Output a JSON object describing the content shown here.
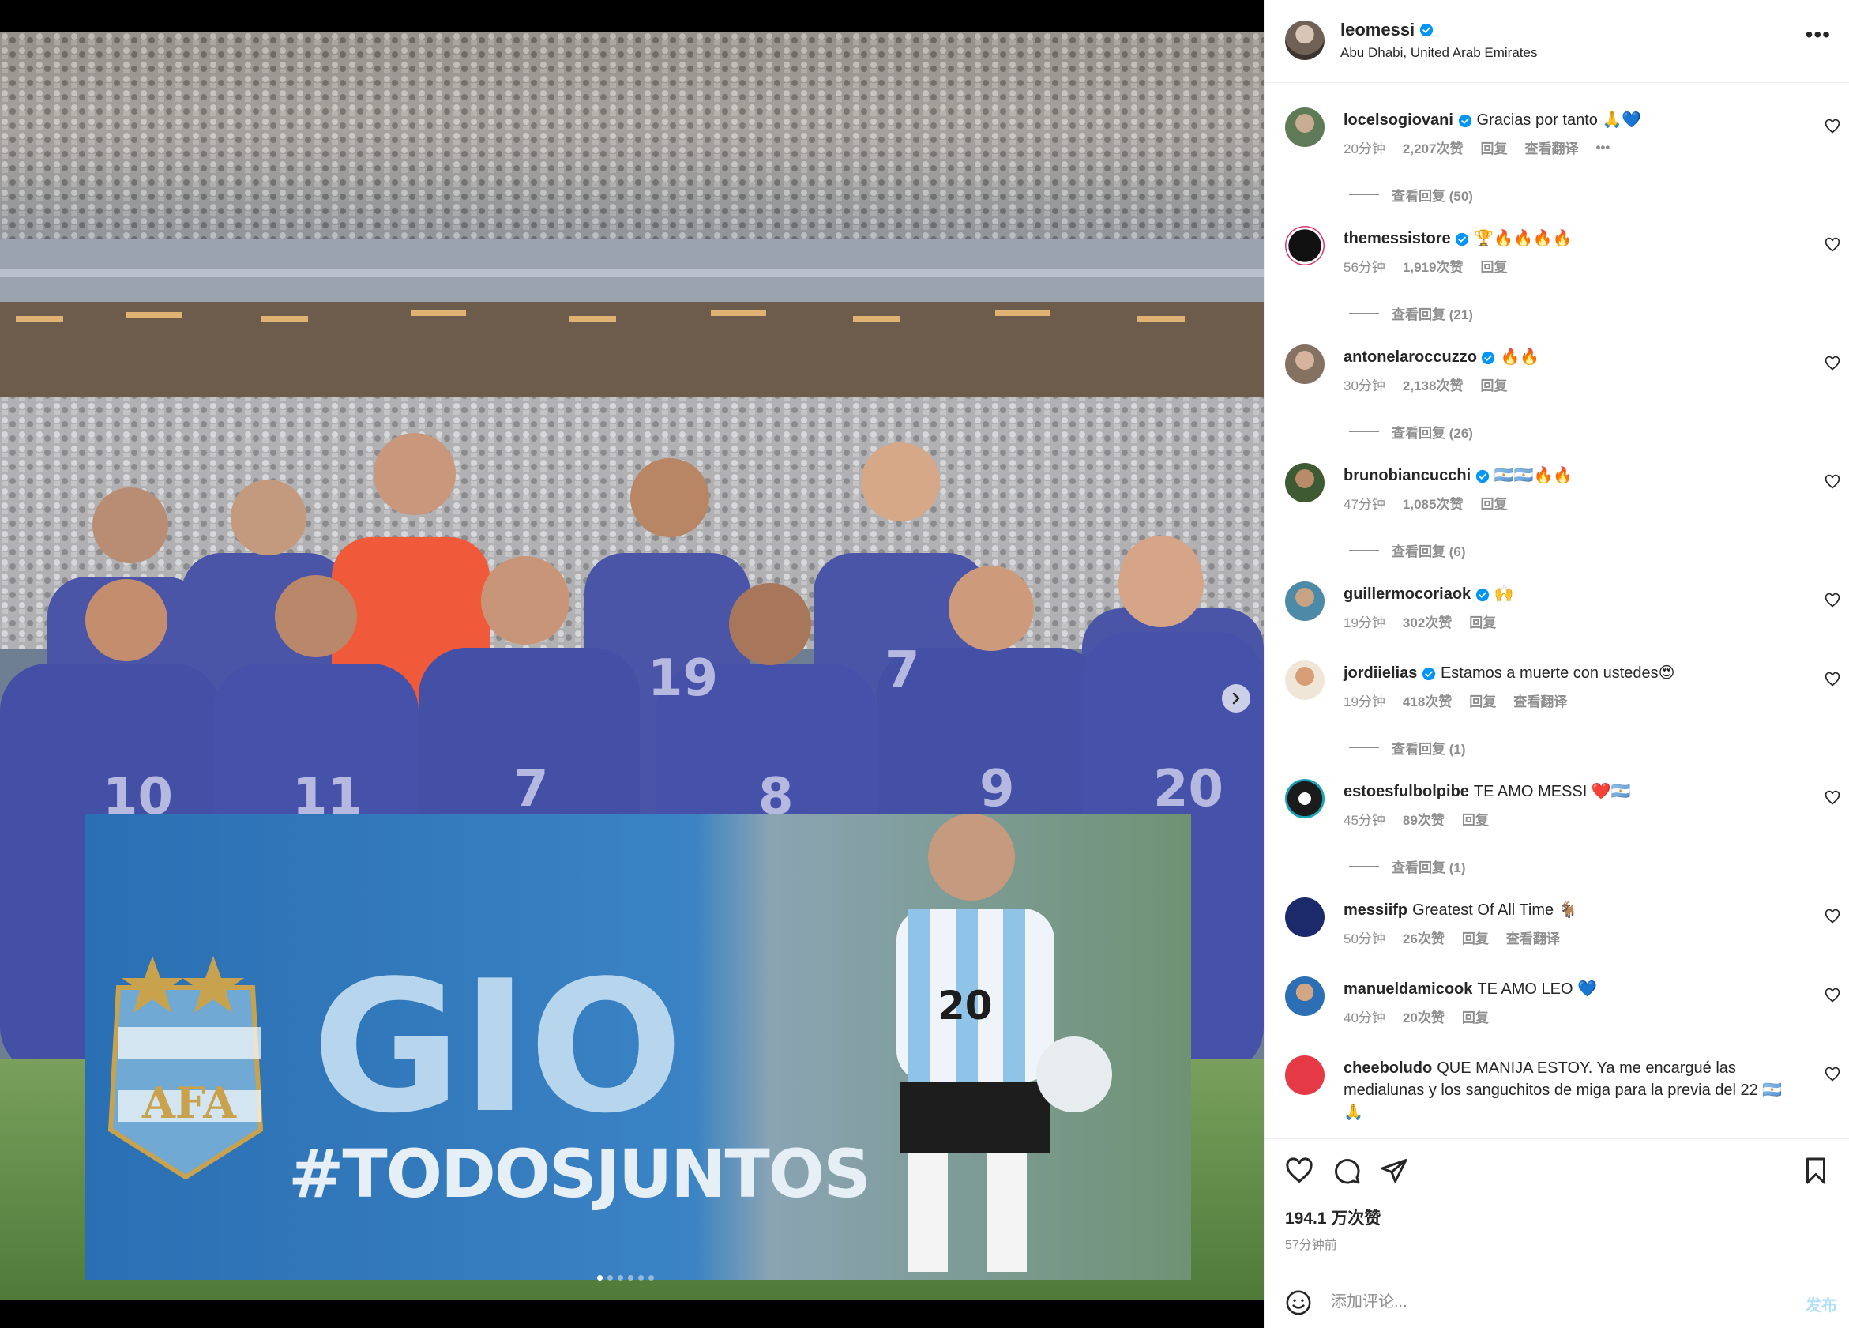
{
  "post": {
    "username": "leomessi",
    "location": "Abu Dhabi, United Arab Emirates",
    "likes": "194.1 万次赞",
    "posted_ago": "57分钟前"
  },
  "media": {
    "banner_text": "GIO",
    "banner_hashtag": "#TODOSJUNTOS",
    "shield_text": "AFA",
    "player_number": "20",
    "jersey_numbers": [
      "10",
      "11",
      "7",
      "19",
      "8",
      "7",
      "9",
      "20"
    ],
    "carousel_count": 6,
    "carousel_index": 0
  },
  "comments": [
    {
      "user": "locelsogiovani",
      "text": "Gracias por tanto 🙏💙",
      "time": "20分钟",
      "likes": "2,207次赞",
      "reply": "回复",
      "translate": "查看翻译",
      "more": "•••",
      "replies": "查看回复 (50)"
    },
    {
      "user": "themessistore",
      "text": "🏆🔥🔥🔥🔥",
      "time": "56分钟",
      "likes": "1,919次赞",
      "reply": "回复",
      "replies": "查看回复 (21)"
    },
    {
      "user": "antonelaroccuzzo",
      "text": "🔥🔥",
      "time": "30分钟",
      "likes": "2,138次赞",
      "reply": "回复",
      "replies": "查看回复 (26)"
    },
    {
      "user": "brunobiancucchi",
      "text": "🇦🇷🇦🇷🔥🔥",
      "time": "47分钟",
      "likes": "1,085次赞",
      "reply": "回复",
      "replies": "查看回复 (6)"
    },
    {
      "user": "guillermocoriaok",
      "text": "🙌",
      "time": "19分钟",
      "likes": "302次赞",
      "reply": "回复"
    },
    {
      "user": "jordiielias",
      "text": "Estamos a muerte con ustedes😍",
      "time": "19分钟",
      "likes": "418次赞",
      "reply": "回复",
      "translate": "查看翻译",
      "replies": "查看回复 (1)"
    },
    {
      "user": "estoesfulbolpibe",
      "text": "TE AMO MESSI ❤️🇦🇷",
      "time": "45分钟",
      "likes": "89次赞",
      "reply": "回复",
      "replies": "查看回复 (1)"
    },
    {
      "user": "messiifp",
      "text": "Greatest Of All Time 🐐",
      "time": "50分钟",
      "likes": "26次赞",
      "reply": "回复",
      "translate": "查看翻译"
    },
    {
      "user": "manueldamicook",
      "text": "TE AMO LEO 💙",
      "time": "40分钟",
      "likes": "20次赞",
      "reply": "回复"
    },
    {
      "user": "cheeboludo",
      "text": "QUE MANIJA ESTOY. Ya me encargué las medialunas y los sanguchitos de miga para la previa del 22 🇦🇷 🙏"
    }
  ],
  "comment_box": {
    "placeholder": "添加评论...",
    "post_label": "发布"
  },
  "icons": {
    "header_more": "more-horizontal-icon",
    "verified": "verified-badge-icon",
    "like": "heart-icon",
    "comment": "comment-bubble-icon",
    "share": "paper-plane-icon",
    "save": "bookmark-icon",
    "emoji": "emoji-smile-icon",
    "next": "chevron-right-icon"
  },
  "colors": {
    "verified_blue": "#0095f6",
    "text_primary": "#262626",
    "text_secondary": "#8e8e8e",
    "post_button": "#b2dffc",
    "jersey_purple": "#4b55a8",
    "banner_blue": "#2c71b5"
  }
}
